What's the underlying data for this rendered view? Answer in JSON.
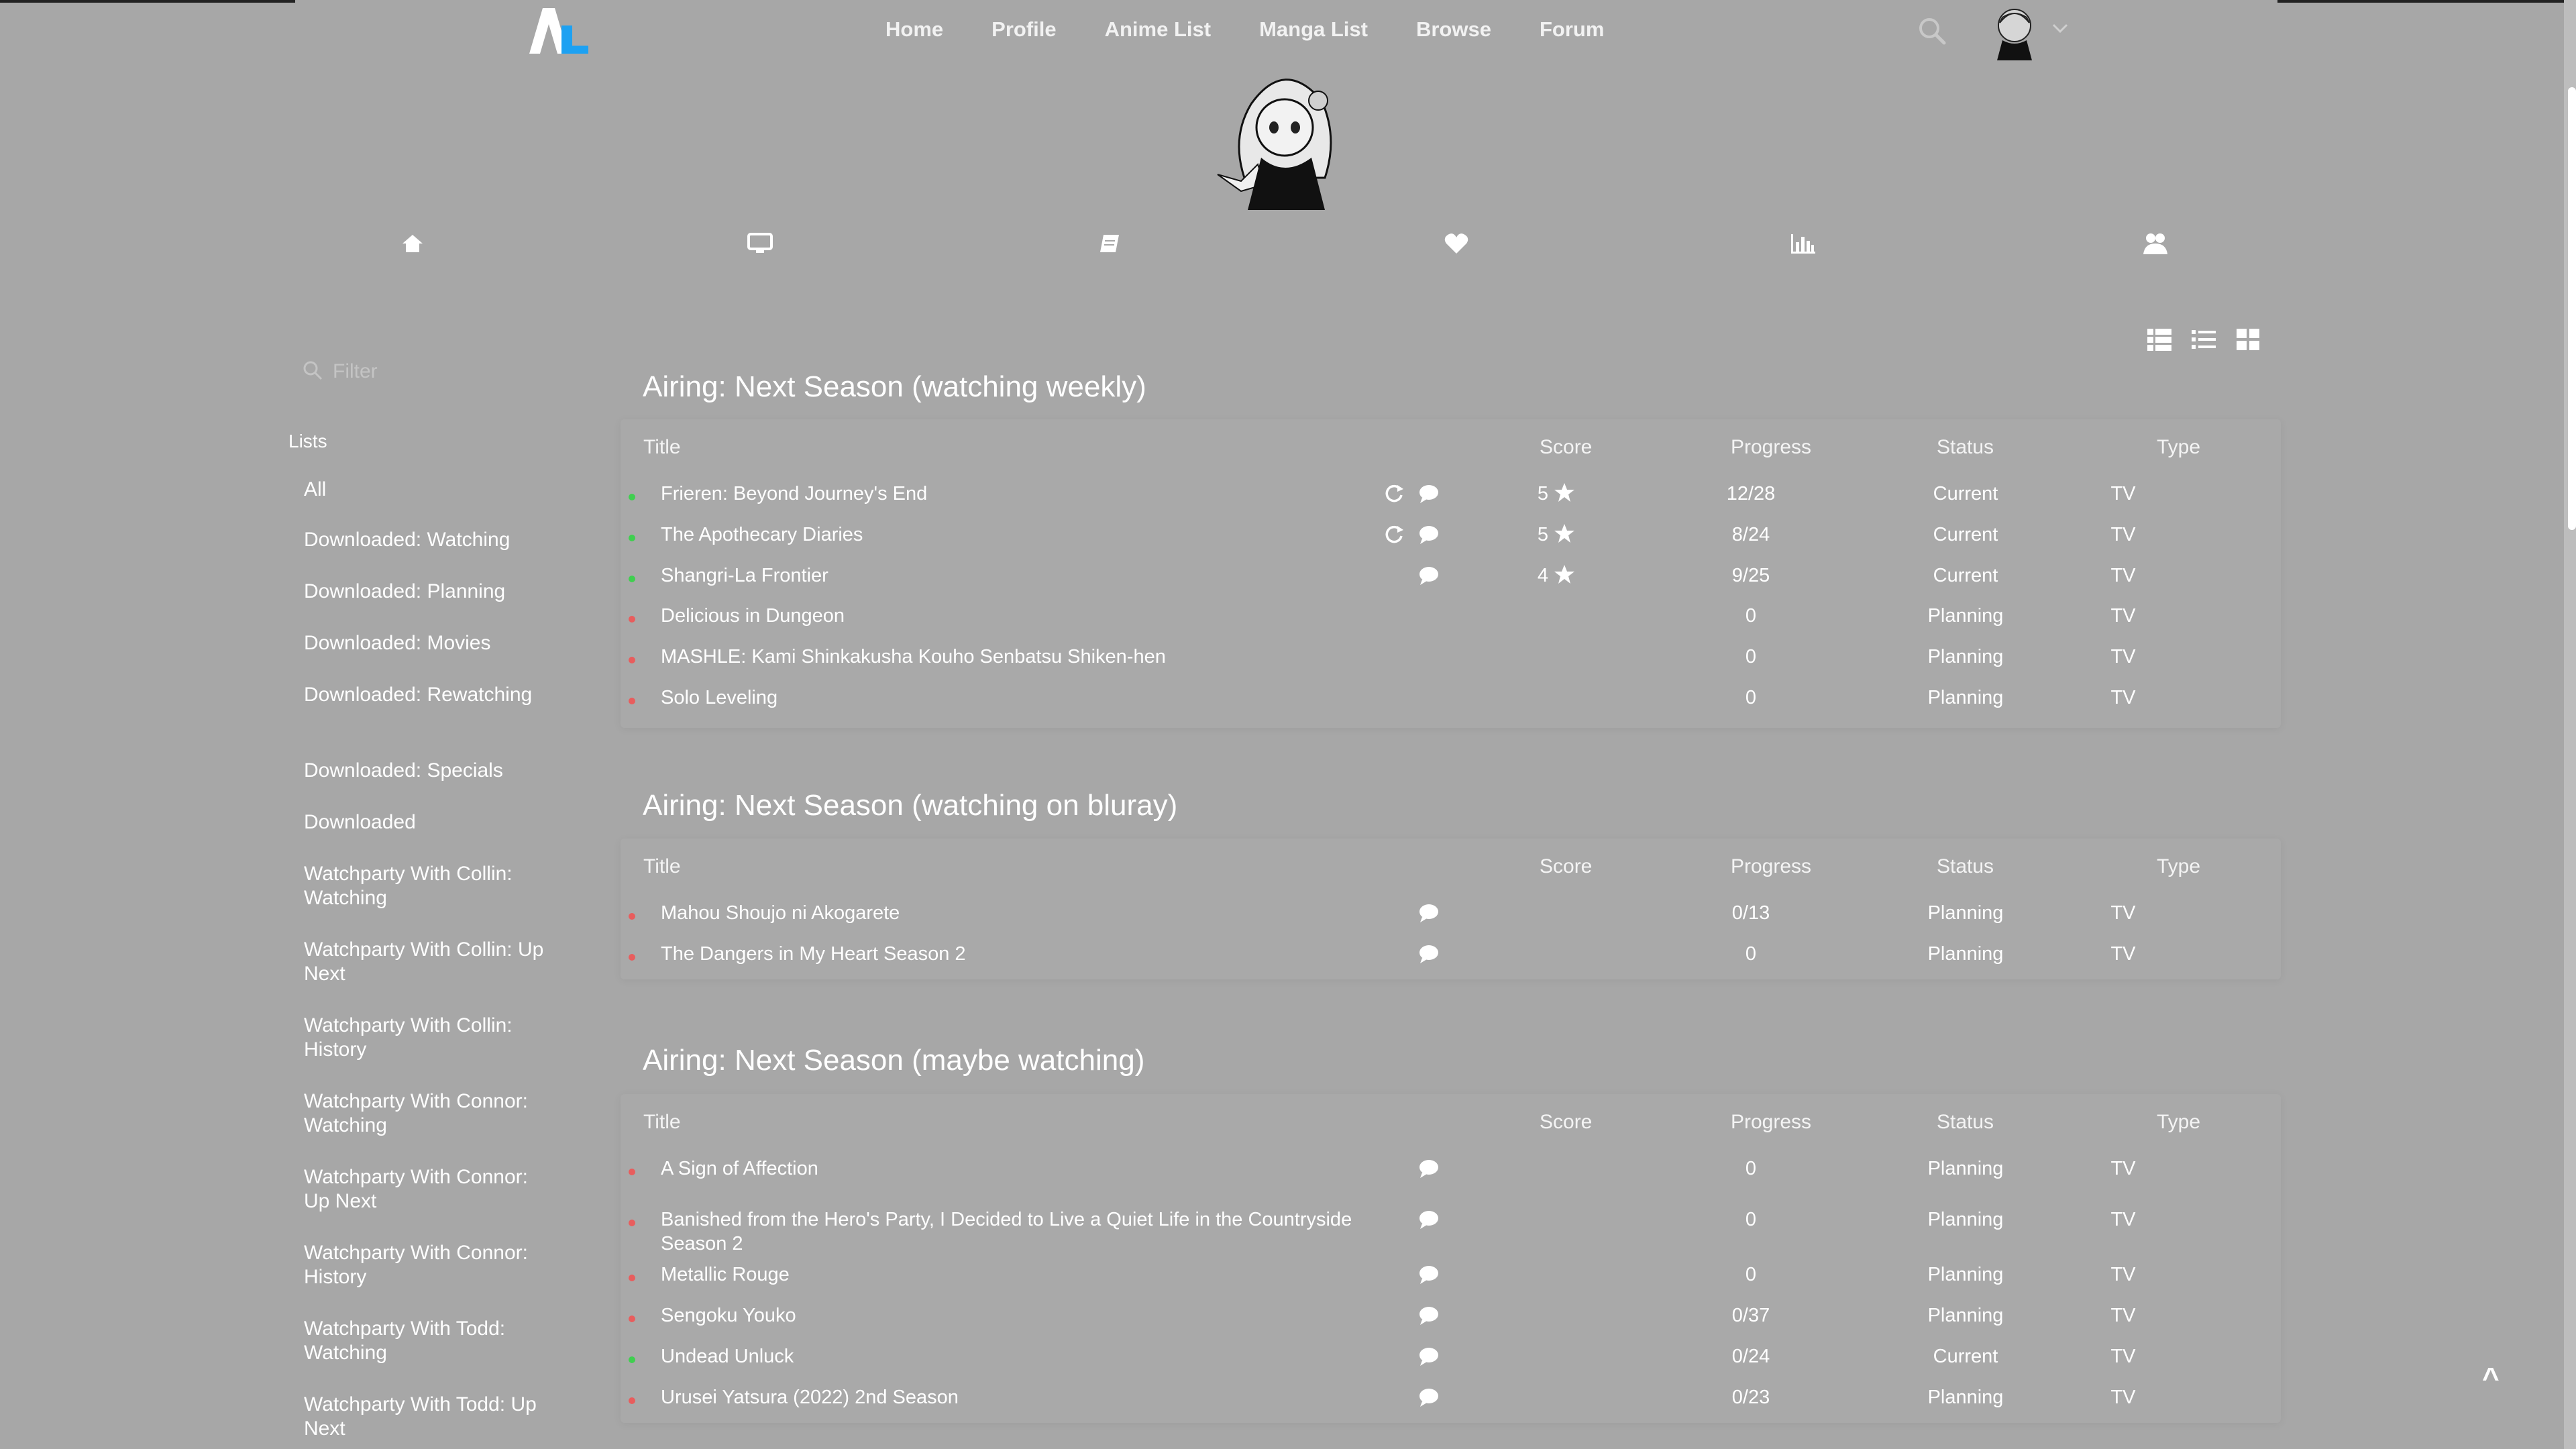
{
  "app": {
    "logo_text": "AL",
    "accent": "#1da1f2"
  },
  "nav": {
    "items": [
      "Home",
      "Profile",
      "Anime List",
      "Manga List",
      "Browse",
      "Forum"
    ]
  },
  "profile_tabs": [
    "home-icon",
    "tv-icon",
    "book-icon",
    "heart-icon",
    "stats-icon",
    "social-icon"
  ],
  "view_modes": [
    "table-view-icon",
    "list-view-icon",
    "grid-view-icon"
  ],
  "sidebar": {
    "filter_placeholder": "Filter",
    "lists_heading": "Lists",
    "items": [
      "All",
      "Downloaded: Watching",
      "Downloaded: Planning",
      "Downloaded: Movies",
      "Downloaded: Rewatching",
      "Downloaded: Specials",
      "Downloaded",
      "Watchparty With Collin: Watching",
      "Watchparty With Collin: Up Next",
      "Watchparty With Collin: History",
      "Watchparty With Connor: Watching",
      "Watchparty With Connor: Up Next",
      "Watchparty With Connor: History",
      "Watchparty With Todd: Watching",
      "Watchparty With Todd: Up Next"
    ]
  },
  "columns": {
    "title": "Title",
    "score": "Score",
    "progress": "Progress",
    "status": "Status",
    "type": "Type"
  },
  "status_colors": {
    "current": "#3fcf4f",
    "planning": "#e85d5d"
  },
  "sections": [
    {
      "title": "Airing: Next Season (watching weekly)",
      "rows": [
        {
          "title": "Frieren: Beyond Journey's End",
          "score": "5",
          "progress": "12/28",
          "status": "Current",
          "type": "TV",
          "state": "current",
          "repeat": true,
          "notes": true
        },
        {
          "title": "The Apothecary Diaries",
          "score": "5",
          "progress": "8/24",
          "status": "Current",
          "type": "TV",
          "state": "current",
          "repeat": true,
          "notes": true
        },
        {
          "title": "Shangri-La Frontier",
          "score": "4",
          "progress": "9/25",
          "status": "Current",
          "type": "TV",
          "state": "current",
          "repeat": false,
          "notes": true
        },
        {
          "title": "Delicious in Dungeon",
          "score": "",
          "progress": "0",
          "status": "Planning",
          "type": "TV",
          "state": "planning",
          "repeat": false,
          "notes": false
        },
        {
          "title": "MASHLE: Kami Shinkakusha Kouho Senbatsu Shiken-hen",
          "score": "",
          "progress": "0",
          "status": "Planning",
          "type": "TV",
          "state": "planning",
          "repeat": false,
          "notes": false
        },
        {
          "title": "Solo Leveling",
          "score": "",
          "progress": "0",
          "status": "Planning",
          "type": "TV",
          "state": "planning",
          "repeat": false,
          "notes": false
        }
      ]
    },
    {
      "title": "Airing: Next Season (watching on bluray)",
      "rows": [
        {
          "title": "Mahou Shoujo ni Akogarete",
          "score": "",
          "progress": "0/13",
          "status": "Planning",
          "type": "TV",
          "state": "planning",
          "repeat": false,
          "notes": true
        },
        {
          "title": "The Dangers in My Heart Season 2",
          "score": "",
          "progress": "0",
          "status": "Planning",
          "type": "TV",
          "state": "planning",
          "repeat": false,
          "notes": true
        }
      ]
    },
    {
      "title": "Airing: Next Season (maybe watching)",
      "rows": [
        {
          "title": "A Sign of Affection",
          "score": "",
          "progress": "0",
          "status": "Planning",
          "type": "TV",
          "state": "planning",
          "repeat": false,
          "notes": true
        },
        {
          "title": "Banished from the Hero's Party, I Decided to Live a Quiet Life in the Countryside Season 2",
          "score": "",
          "progress": "0",
          "status": "Planning",
          "type": "TV",
          "state": "planning",
          "repeat": false,
          "notes": true
        },
        {
          "title": "Metallic Rouge",
          "score": "",
          "progress": "0",
          "status": "Planning",
          "type": "TV",
          "state": "planning",
          "repeat": false,
          "notes": true
        },
        {
          "title": "Sengoku Youko",
          "score": "",
          "progress": "0/37",
          "status": "Planning",
          "type": "TV",
          "state": "planning",
          "repeat": false,
          "notes": true
        },
        {
          "title": "Undead Unluck",
          "score": "",
          "progress": "0/24",
          "status": "Current",
          "type": "TV",
          "state": "current",
          "repeat": false,
          "notes": true
        },
        {
          "title": "Urusei Yatsura (2022) 2nd Season",
          "score": "",
          "progress": "0/23",
          "status": "Planning",
          "type": "TV",
          "state": "planning",
          "repeat": false,
          "notes": true
        }
      ]
    }
  ],
  "scroll_top_label": "^"
}
